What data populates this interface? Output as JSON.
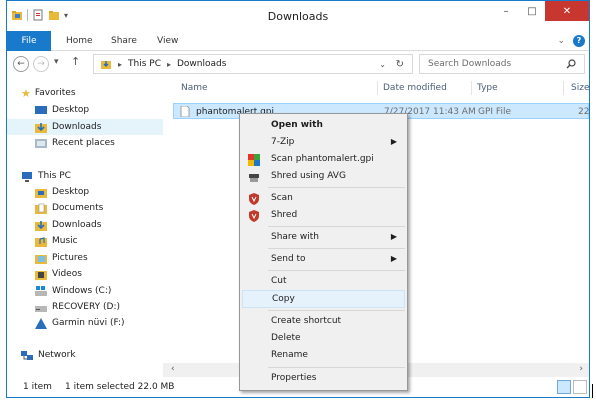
{
  "window": {
    "title": "Downloads"
  },
  "ribbon": {
    "file": "File",
    "home": "Home",
    "share": "Share",
    "view": "View"
  },
  "address": {
    "this_pc": "This PC",
    "downloads": "Downloads",
    "search_placeholder": "Search Downloads"
  },
  "nav": {
    "favorites": "Favorites",
    "favorites_items": [
      "Desktop",
      "Downloads",
      "Recent places"
    ],
    "this_pc": "This PC",
    "pc_items": [
      "Desktop",
      "Documents",
      "Downloads",
      "Music",
      "Pictures",
      "Videos",
      "Windows (C:)",
      "RECOVERY (D:)",
      "Garmin nüvi (F:)"
    ],
    "network": "Network"
  },
  "columns": {
    "name": "Name",
    "date": "Date modified",
    "type": "Type",
    "size": "Size"
  },
  "file": {
    "name": "phantomalert.gpi",
    "date": "7/27/2017 11:43 AM",
    "type": "GPI File",
    "size": "22"
  },
  "status": {
    "count": "1 item",
    "selected": "1 item selected  22.0 MB"
  },
  "menu": {
    "open_with": "Open with",
    "seven_zip": "7-Zip",
    "scan_file": "Scan phantomalert.gpi",
    "shred_avg": "Shred using AVG",
    "scan": "Scan",
    "shred": "Shred",
    "share_with": "Share with",
    "send_to": "Send to",
    "cut": "Cut",
    "copy": "Copy",
    "create_shortcut": "Create shortcut",
    "delete": "Delete",
    "rename": "Rename",
    "properties": "Properties"
  },
  "colors": {
    "accent": "#1979ca",
    "selection": "#cce8ff",
    "close": "#c7372f"
  }
}
